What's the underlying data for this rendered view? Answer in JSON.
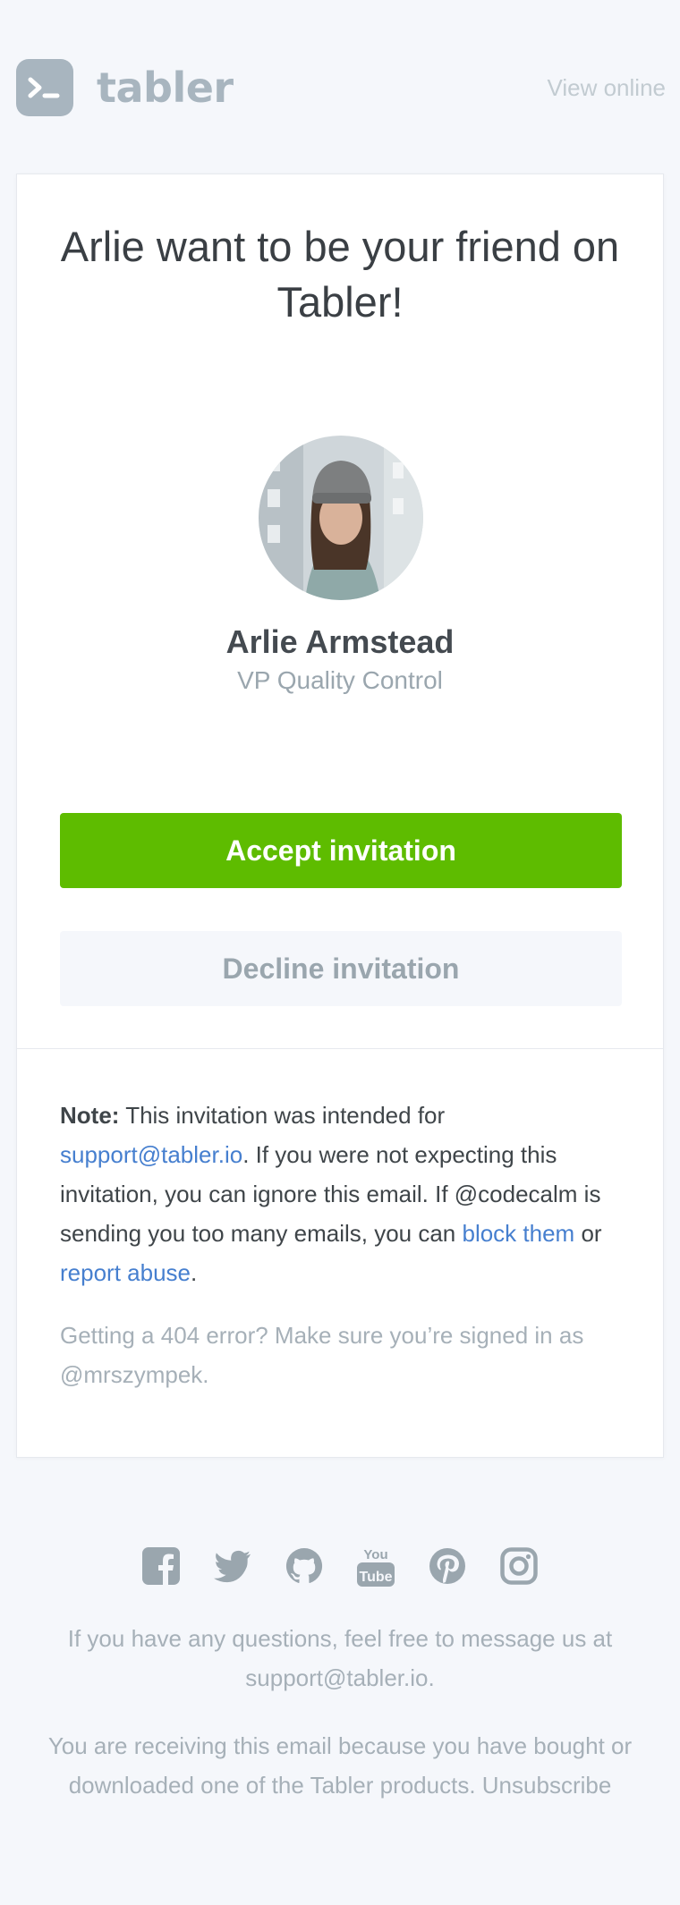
{
  "header": {
    "brand_name": "tabler",
    "view_online_label": "View online"
  },
  "card": {
    "title": "Arlie want to be your friend on Tabler!",
    "person": {
      "name": "Arlie Armstead",
      "role": "VP Quality Control"
    },
    "accept_label": "Accept invitation",
    "decline_label": "Decline invitation",
    "note": {
      "label": "Note:",
      "text_1": " This invitation was intended for ",
      "email": "support@tabler.io",
      "text_2": ". If you were not expecting this invitation, you can ignore this email. If @codecalm is sending you too many emails, you can ",
      "block_link": "block them",
      "text_3": " or ",
      "report_link": "report abuse",
      "text_4": "."
    },
    "help_text": "Getting a 404 error? Make sure you’re signed in as @mrszympek."
  },
  "footer": {
    "social_icons": [
      "facebook-icon",
      "twitter-icon",
      "github-icon",
      "youtube-icon",
      "pinterest-icon",
      "instagram-icon"
    ],
    "questions_text": "If you have any questions, feel free to message us at support@tabler.io.",
    "receiving_text": "You are receiving this email because you have bought or downloaded one of the Tabler products. ",
    "unsubscribe_label": "Unsubscribe"
  },
  "colors": {
    "accent_green": "#5ebc00",
    "link_blue": "#467fcf",
    "brand_gray": "#a8b5bf",
    "background": "#f5f7fb"
  }
}
